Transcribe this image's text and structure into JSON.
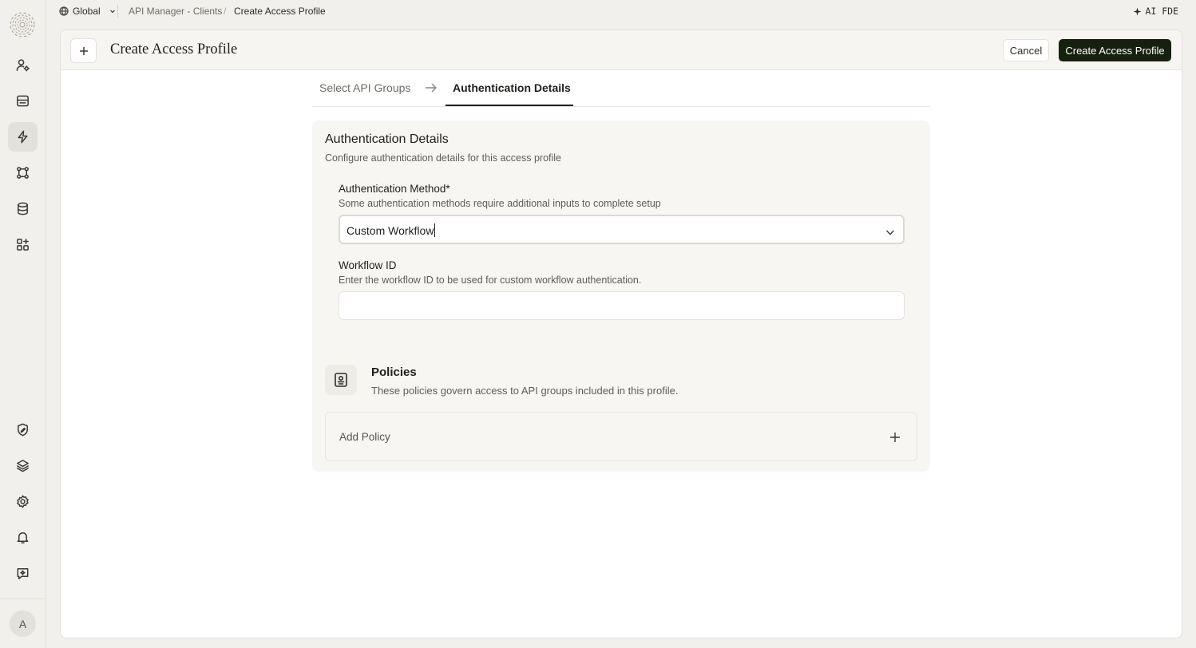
{
  "topbar": {
    "scope": "Global",
    "breadcrumb_parent": "API Manager - Clients",
    "breadcrumb_current": "Create Access Profile",
    "ai_label": "AI FDE"
  },
  "sidebar": {
    "avatar_initial": "A",
    "items": [
      {
        "icon": "user-settings-icon"
      },
      {
        "icon": "inbox-icon"
      },
      {
        "icon": "lightning-icon",
        "active": true
      },
      {
        "icon": "workflow-icon"
      },
      {
        "icon": "database-icon"
      },
      {
        "icon": "apps-add-icon"
      },
      {
        "icon": "shield-edit-icon"
      },
      {
        "icon": "layers-icon"
      },
      {
        "icon": "settings-icon"
      },
      {
        "icon": "bell-icon"
      },
      {
        "icon": "ai-chat-icon"
      }
    ]
  },
  "header": {
    "title": "Create Access Profile",
    "cancel_label": "Cancel",
    "create_label": "Create Access Profile"
  },
  "tabs": {
    "step1": "Select API Groups",
    "step2": "Authentication Details"
  },
  "auth": {
    "title": "Authentication Details",
    "subtitle": "Configure authentication details for this access profile",
    "method_label": "Authentication Method*",
    "method_help": "Some authentication methods require additional inputs to complete setup",
    "method_value": "Custom Workflow",
    "workflow_label": "Workflow ID",
    "workflow_help": "Enter the workflow ID to be used for custom workflow authentication.",
    "workflow_value": ""
  },
  "policies": {
    "title": "Policies",
    "subtitle": "These policies govern access to API groups included in this profile.",
    "add_label": "Add Policy"
  },
  "colors": {
    "primary_button": "#16200f",
    "background": "#f1f0ec",
    "card": "#f7f6f3"
  }
}
